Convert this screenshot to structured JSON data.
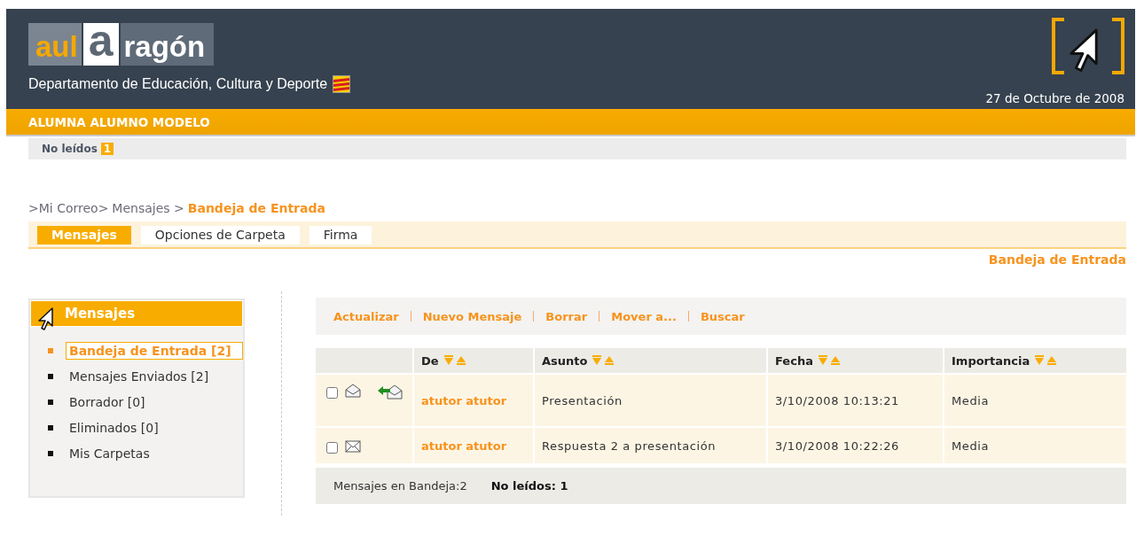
{
  "header": {
    "logo": {
      "part_1": "aul",
      "part_2": "a",
      "part_3": "ragón"
    },
    "department": "Departamento de Educación, Cultura y Deporte",
    "date": "27 de Octubre de 2008"
  },
  "user_bar": {
    "name": "ALUMNA ALUMNO MODELO"
  },
  "unread_bar": {
    "label": "No leídos",
    "count": "1"
  },
  "breadcrumb": {
    "links": [
      ">Mi Correo>",
      "Mensajes >"
    ],
    "current": "Bandeja de Entrada"
  },
  "tabs": [
    {
      "label": "Mensajes",
      "selected": true
    },
    {
      "label": "Opciones de Carpeta",
      "selected": false
    },
    {
      "label": "Firma",
      "selected": false
    }
  ],
  "folder_title": "Bandeja de Entrada",
  "sidebar": {
    "title": "Mensajes",
    "items": [
      {
        "label": "Bandeja de Entrada [2]",
        "selected": true
      },
      {
        "label": "Mensajes Enviados [2]",
        "selected": false
      },
      {
        "label": "Borrador [0]",
        "selected": false
      },
      {
        "label": "Eliminados [0]",
        "selected": false
      },
      {
        "label": "Mis Carpetas",
        "selected": false
      }
    ]
  },
  "toolbar": [
    "Actualizar",
    "Nuevo Mensaje",
    "Borrar",
    "Mover a...",
    "Buscar"
  ],
  "table": {
    "columns": [
      "De",
      "Asunto",
      "Fecha",
      "Importancia"
    ],
    "rows": [
      {
        "checked": false,
        "read": true,
        "replied": true,
        "from": "atutor atutor",
        "subject": "Presentación",
        "date": "3/10/2008 10:13:21",
        "importance": "Media"
      },
      {
        "checked": false,
        "read": false,
        "replied": false,
        "from": "atutor atutor",
        "subject": "Respuesta 2 a presentación",
        "date": "3/10/2008 10:22:26",
        "importance": "Media"
      }
    ]
  },
  "footer": {
    "total": "Mensajes en Bandeja:2",
    "unread": "No leídos: 1"
  }
}
